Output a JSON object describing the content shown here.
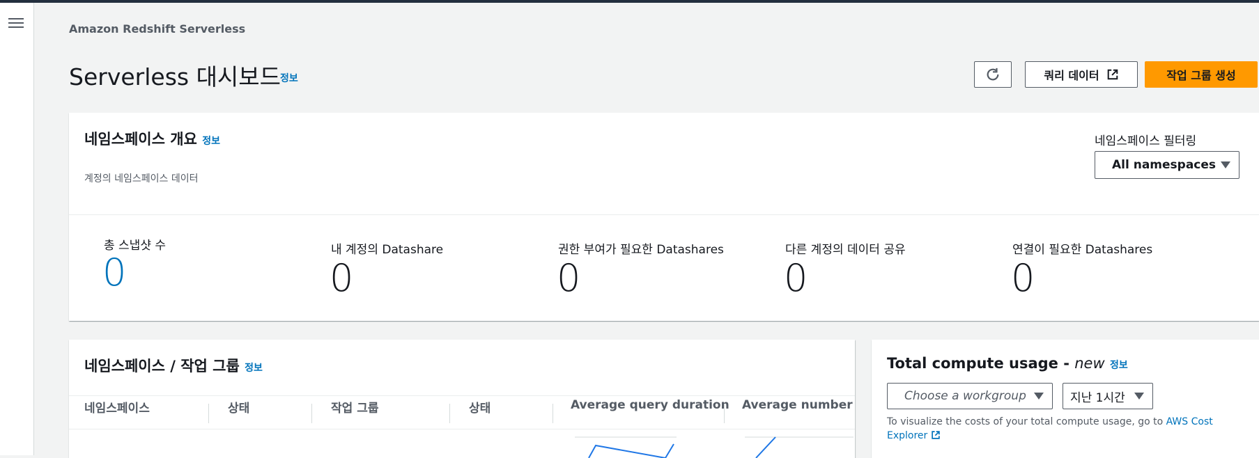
{
  "breadcrumb": "Amazon Redshift Serverless",
  "page": {
    "title": "Serverless 대시보드",
    "info": "정보"
  },
  "actions": {
    "query_data": "쿼리 데이터",
    "create_workgroup": "작업 그룹 생성"
  },
  "overview": {
    "title": "네임스페이스 개요",
    "info": "정보",
    "subtitle": "계정의 네임스페이스 데이터",
    "filter_label": "네임스페이스 필터링",
    "filter_value": "All namespaces",
    "stats": [
      {
        "label": "총 스냅샷 수",
        "value": "0"
      },
      {
        "label": "내 계정의 Datashare",
        "value": "0"
      },
      {
        "label": "권한 부여가 필요한 Datashares",
        "value": "0"
      },
      {
        "label": "다른 계정의 데이터 공유",
        "value": "0"
      },
      {
        "label": "연결이 필요한 Datashares",
        "value": "0"
      }
    ]
  },
  "namespaces": {
    "title": "네임스페이스 / 작업 그룹",
    "info": "정보",
    "columns": [
      "네임스페이스",
      "상태",
      "작업 그룹",
      "상태",
      "Average query duration",
      "Average number of"
    ]
  },
  "compute": {
    "title": "Total compute usage - ",
    "title_new": "new",
    "info": "정보",
    "workgroup_placeholder": "Choose a workgroup",
    "time_range": "지난 1시간",
    "note": "To visualize the costs of your total compute usage, go to ",
    "note_link": "AWS Cost Explorer"
  },
  "colors": {
    "accent": "#ff9900",
    "link": "#0073bb",
    "stat_highlight": "#0073bb"
  }
}
